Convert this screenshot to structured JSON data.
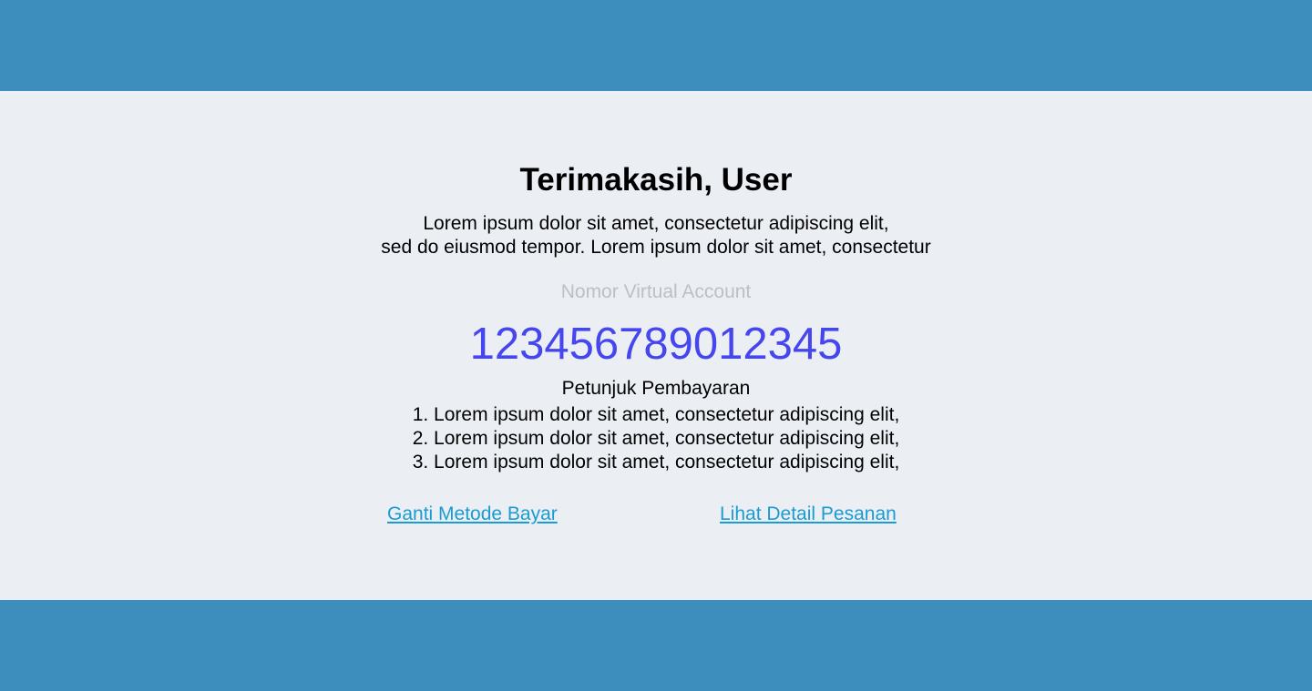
{
  "header": {},
  "content": {
    "title": "Terimakasih, User",
    "intro_lines": [
      "Lorem ipsum dolor sit amet,  consectetur adipiscing elit,",
      "sed do eiusmod tempor. Lorem ipsum dolor sit amet,  consectetur"
    ],
    "va_label": "Nomor Virtual Account",
    "va_number": "123456789012345",
    "instructions_title": "Petunjuk Pembayaran",
    "steps": [
      "1. Lorem ipsum dolor sit amet,  consectetur adipiscing elit,",
      "2. Lorem ipsum dolor sit amet,  consectetur adipiscing elit,",
      "3. Lorem ipsum dolor sit amet,  consectetur adipiscing elit,"
    ],
    "links": {
      "change_method": "Ganti Metode Bayar",
      "order_detail": "Lihat Detail Pesanan"
    }
  },
  "colors": {
    "bar": "#3d8ebd",
    "background": "#ebeff4",
    "accent_number": "#4646ef",
    "link": "#1a9bd3",
    "muted_label": "#bcbfc4"
  }
}
